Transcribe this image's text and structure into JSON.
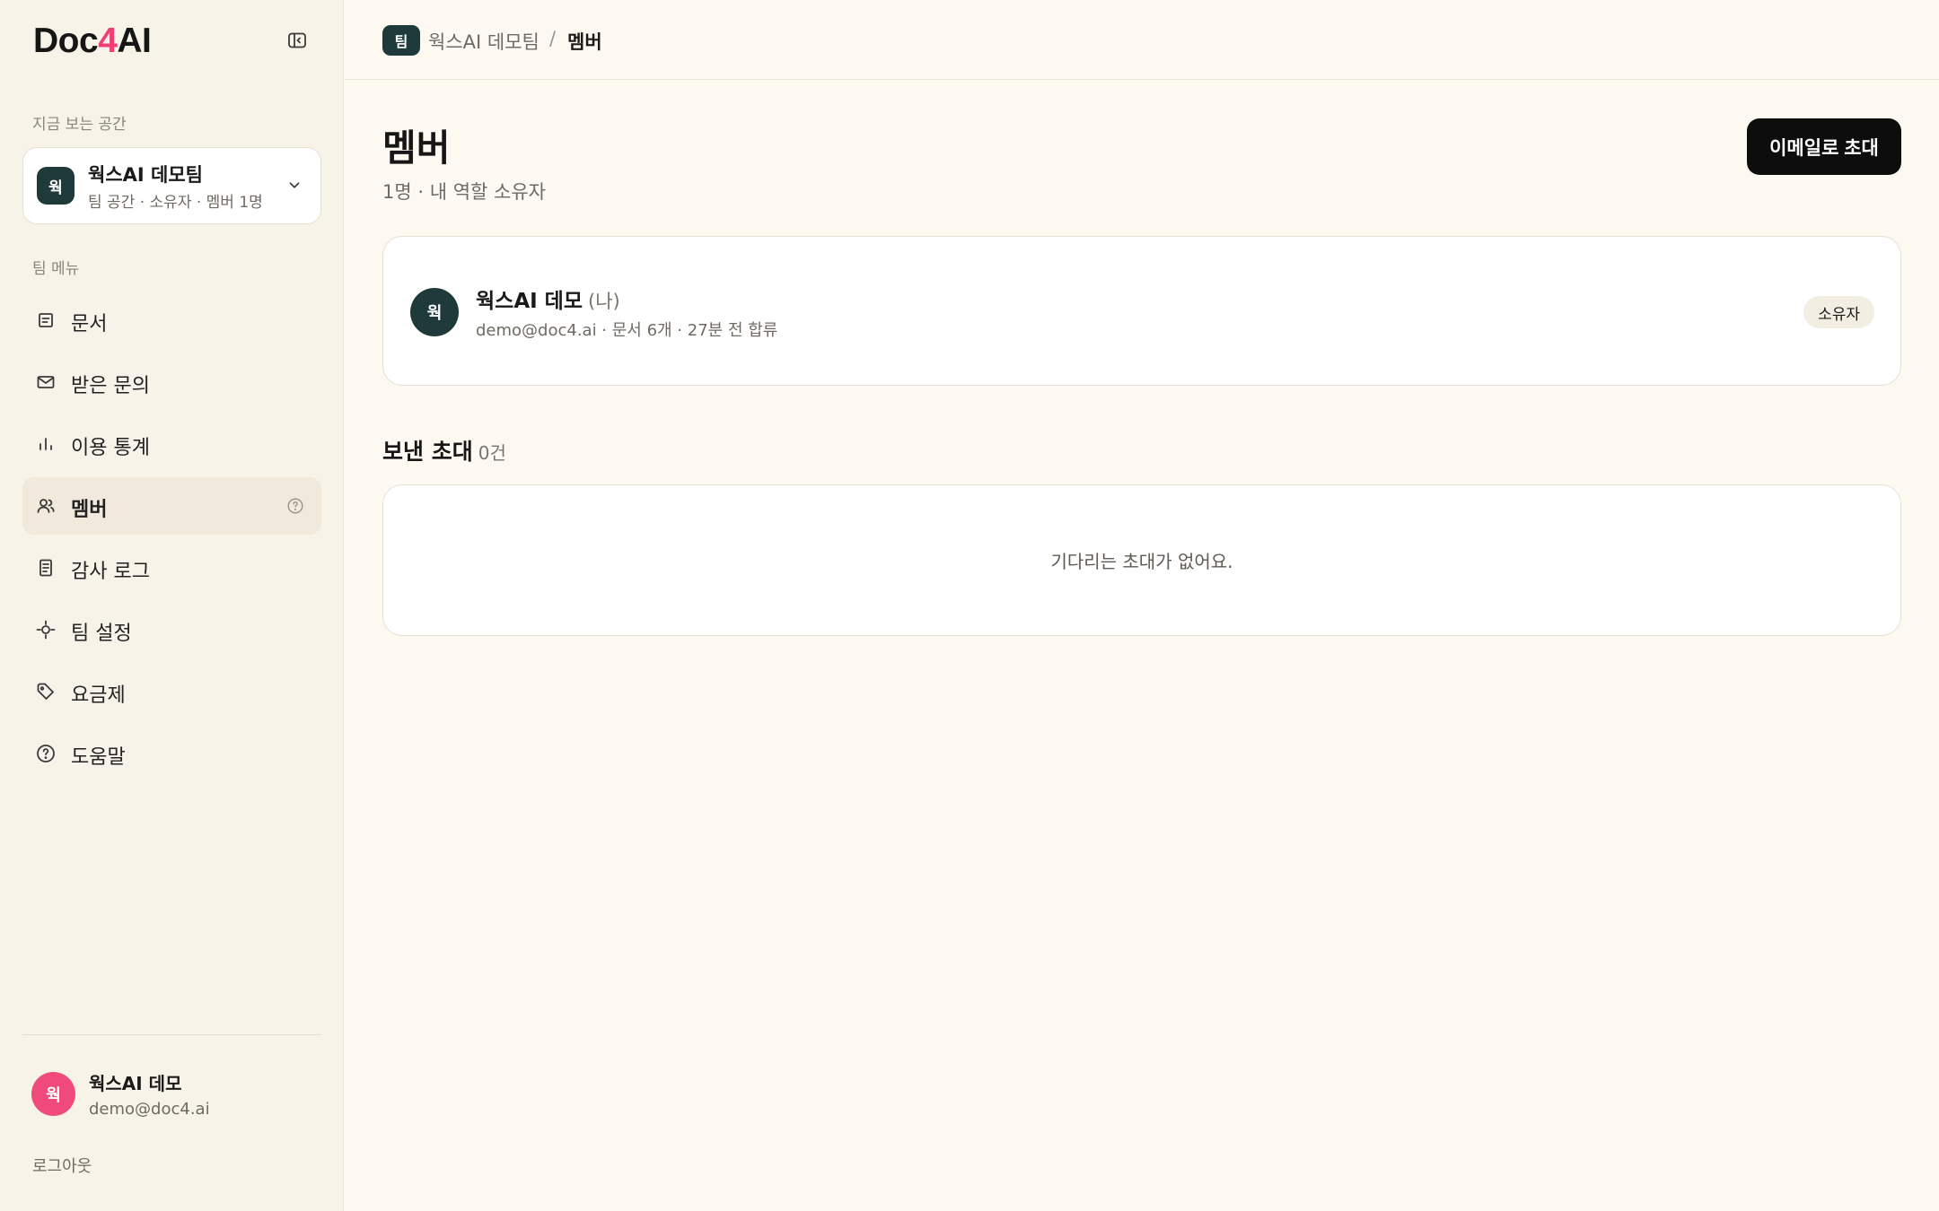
{
  "app": {
    "logo_prefix": "Doc",
    "logo_four": "4",
    "logo_suffix": "AI"
  },
  "sidebar": {
    "current_space_label": "지금 보는 공간",
    "workspace": {
      "avatar": "웍",
      "name": "웍스AI 데모팀",
      "meta": "팀 공간 · 소유자 · 멤버 1명"
    },
    "team_menu_label": "팀 메뉴",
    "items": [
      {
        "label": "문서",
        "icon": "document-icon"
      },
      {
        "label": "받은 문의",
        "icon": "mail-icon"
      },
      {
        "label": "이용 통계",
        "icon": "bar-chart-icon"
      },
      {
        "label": "멤버",
        "icon": "users-icon",
        "active": true
      },
      {
        "label": "감사 로그",
        "icon": "log-icon"
      },
      {
        "label": "팀 설정",
        "icon": "settings-icon"
      },
      {
        "label": "요금제",
        "icon": "tag-icon"
      },
      {
        "label": "도움말",
        "icon": "help-icon"
      }
    ],
    "user": {
      "avatar": "웍",
      "name": "웍스AI 데모",
      "email": "demo@doc4.ai"
    },
    "logout_label": "로그아웃"
  },
  "breadcrumb": {
    "badge": "팀",
    "team": "웍스AI 데모팀",
    "separator": "/",
    "current": "멤버"
  },
  "main": {
    "title": "멤버",
    "subtitle": "1명 · 내 역할 소유자",
    "invite_button": "이메일로 초대",
    "member": {
      "avatar": "웍",
      "name": "웍스AI 데모",
      "me_tag": "(나)",
      "meta": "demo@doc4.ai · 문서 6개 · 27분 전 합류",
      "role": "소유자"
    },
    "sent_invites": {
      "title": "보낸 초대",
      "count": "0건",
      "empty_text": "기다리는 초대가 없어요."
    }
  },
  "colors": {
    "background": "#fdf9f0",
    "sidebar": "#f8f3e9",
    "brand_accent": "#ef3f74",
    "dark_teal": "#1f3a3a",
    "primary_button": "#0d0d0d"
  }
}
